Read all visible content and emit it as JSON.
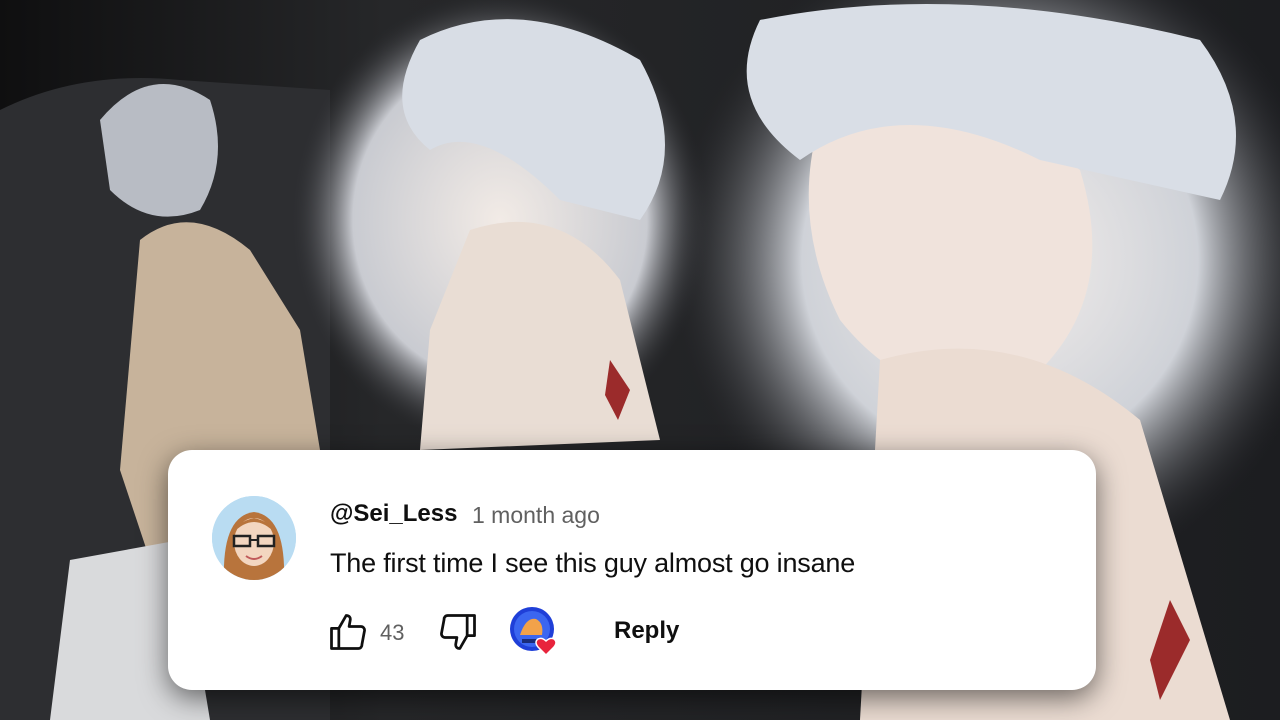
{
  "comment": {
    "handle": "@Sei_Less",
    "timestamp": "1 month ago",
    "text": "The first time I see this guy almost go insane",
    "like_count": "43",
    "reply_label": "Reply"
  },
  "icons": {
    "like": "thumbs-up-icon",
    "dislike": "thumbs-down-icon",
    "creator_heart": "creator-heart-icon",
    "avatar": "user-avatar"
  },
  "colors": {
    "card_background": "#ffffff",
    "text_primary": "#0f0f0f",
    "text_secondary": "#606060",
    "heart": "#e8243c",
    "creator_avatar_ring": "#1f3fd8"
  }
}
